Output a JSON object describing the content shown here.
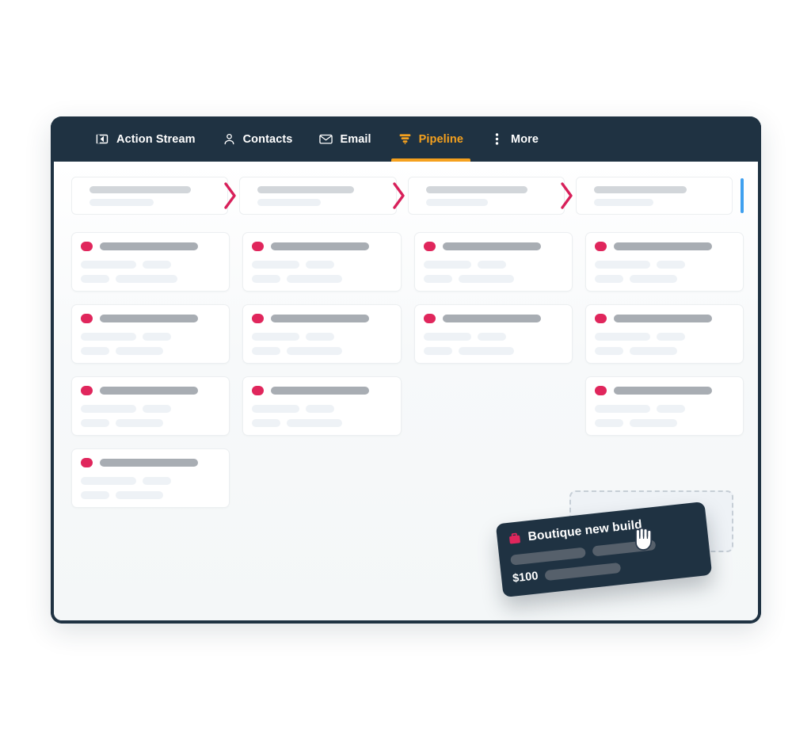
{
  "app": {
    "window_title": "Pipeline"
  },
  "navbar": {
    "items": [
      {
        "label": "Action Stream",
        "icon": "flag-arrow-icon",
        "active": false
      },
      {
        "label": "Contacts",
        "icon": "person-icon",
        "active": false
      },
      {
        "label": "Email",
        "icon": "envelope-icon",
        "active": false
      },
      {
        "label": "Pipeline",
        "icon": "funnel-icon",
        "active": true
      },
      {
        "label": "More",
        "icon": "kebab-menu-icon",
        "active": false
      }
    ],
    "active_tab": "Pipeline",
    "background_color": "#1f3242",
    "active_color": "#f5a11e",
    "text_color": "#ffffff"
  },
  "pipeline": {
    "stages": [
      {
        "name": "",
        "subtitle": ""
      },
      {
        "name": "",
        "subtitle": ""
      },
      {
        "name": "",
        "subtitle": ""
      },
      {
        "name": "",
        "subtitle": ""
      }
    ],
    "separator_color": "#d8205a",
    "scrollbar_color": "#3fa0ef",
    "card_dot_color": "#e0265c",
    "rows": [
      {
        "cells": [
          true,
          true,
          true,
          true
        ]
      },
      {
        "cells": [
          true,
          true,
          true,
          true
        ]
      },
      {
        "cells": [
          true,
          true,
          false,
          true
        ]
      },
      {
        "cells": [
          true,
          false,
          false,
          false
        ]
      }
    ]
  },
  "drag": {
    "card_title": "Boutique new build",
    "amount": "$100",
    "icon": "briefcase-icon",
    "card_background": "#1f3242",
    "icon_color": "#e0265c",
    "cursor": "grabbing-hand-cursor",
    "drop_zone_visible": true
  }
}
